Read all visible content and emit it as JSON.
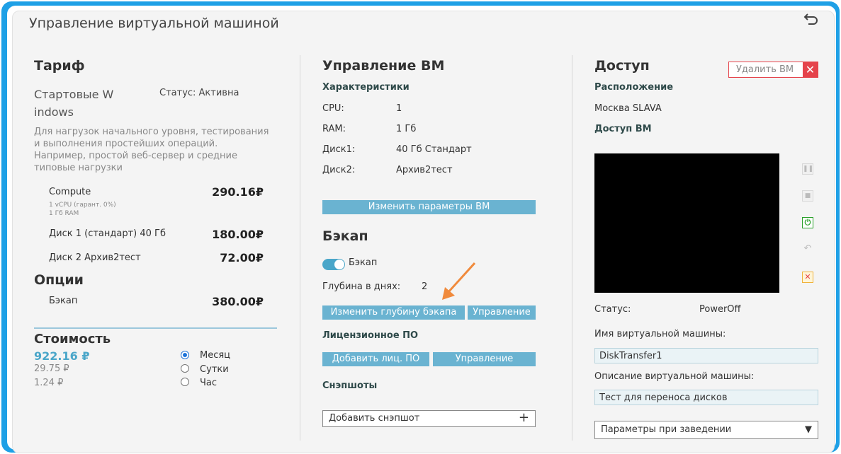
{
  "window": {
    "title": "Управление виртуальной машиной"
  },
  "tariff": {
    "heading": "Тариф",
    "name_line1": "Стартовые W",
    "name_line2": "indows",
    "status": "Статус: Активна",
    "description_lines": [
      "Для нагрузок начального уровня, тестирования",
      "и выполнения простейших операций.",
      "Например, простой веб-сервер и средние",
      "типовые нагрузки"
    ],
    "compute": {
      "label": "Compute",
      "price": "290.16₽",
      "detail1": "1 vCPU (гарант. 0%)",
      "detail2": "1 Гб RAM"
    },
    "disk1": {
      "label": "Диск 1 (стандарт) 40 Гб",
      "price": "180.00₽"
    },
    "disk2": {
      "label": "Диск 2 Архив2тест",
      "price": "72.00₽"
    }
  },
  "options": {
    "heading": "Опции",
    "backup": {
      "label": "Бэкап",
      "price": "380.00₽"
    }
  },
  "cost": {
    "heading": "Стоимость",
    "month_price": "922.16 ₽",
    "day_price": "29.75 ₽",
    "hour_price": "1.24 ₽",
    "periods": [
      {
        "label": "Месяц",
        "selected": true
      },
      {
        "label": "Сутки",
        "selected": false
      },
      {
        "label": "Час",
        "selected": false
      }
    ]
  },
  "vm": {
    "heading": "Управление ВМ",
    "specs_heading": "Характеристики",
    "specs": [
      {
        "key": "CPU:",
        "value": "1"
      },
      {
        "key": "RAM:",
        "value": "1 Гб"
      },
      {
        "key": "Диск1:",
        "value": "40 Гб Стандарт"
      },
      {
        "key": "Диск2:",
        "value": "Архив2тест"
      }
    ],
    "change_params_button": "Изменить параметры ВМ"
  },
  "backup": {
    "heading": "Бэкап",
    "toggle_label": "Бэкап",
    "toggle_on": true,
    "depth_label": "Глубина в днях:",
    "depth_value": "2",
    "change_depth_button": "Изменить глубину бэкапа",
    "manage_button": "Управление"
  },
  "license": {
    "heading": "Лицензионное ПО",
    "add_button": "Добавить лиц. ПО",
    "manage_button": "Управление"
  },
  "snapshots": {
    "heading": "Снэпшоты",
    "add_label": "Добавить снэпшот",
    "plus_icon": "plus-icon"
  },
  "access": {
    "heading": "Доступ",
    "delete_button": "Удалить ВМ",
    "location_heading": "Расположение",
    "location_value": "Москва SLAVA",
    "vm_access_heading": "Доступ ВМ",
    "status_label": "Статус:",
    "status_value": "PowerOff",
    "vm_name_label": "Имя виртуальной машины:",
    "vm_name_value": "DiskTransfer1",
    "vm_desc_label": "Описание виртуальной машины:",
    "vm_desc_value": "Тест для переноса дисков",
    "params_select": "Параметры при заведении",
    "controls": [
      "pause-icon",
      "stop-icon",
      "power-icon",
      "reset-icon",
      "delete-vm-icon"
    ]
  },
  "colors": {
    "accent": "#6ab3d1",
    "frame": "#1ea0e6",
    "annotation_arrow": "#f08a3c",
    "danger": "#e5434b",
    "power_green": "#2aa12a"
  }
}
